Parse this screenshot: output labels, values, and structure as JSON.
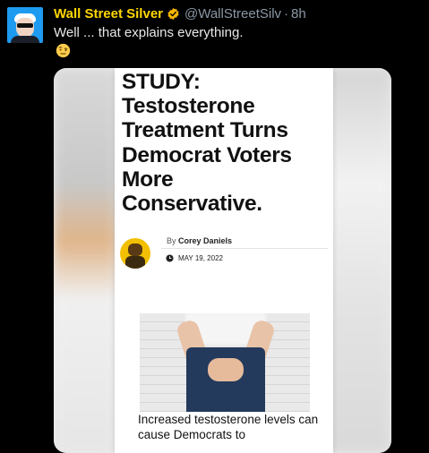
{
  "tweet": {
    "display_name": "Wall Street Silver",
    "handle": "@WallStreetSilv",
    "separator": "·",
    "time": "8h",
    "text": "Well ... that explains everything.",
    "emoji": "face-with-raised-eyebrow",
    "colors": {
      "name": "#ffd700",
      "muted": "#8b98a5",
      "verified": "#f7b500"
    }
  },
  "article": {
    "headline_lines": [
      "STUDY:",
      "Testosterone",
      "Treatment Turns",
      "Democrat Voters",
      "More",
      "Conservative."
    ],
    "by_label": "By",
    "author": "Corey Daniels",
    "date": "MAY 19, 2022",
    "caption": "Increased testosterone levels can cause Democrats to"
  }
}
